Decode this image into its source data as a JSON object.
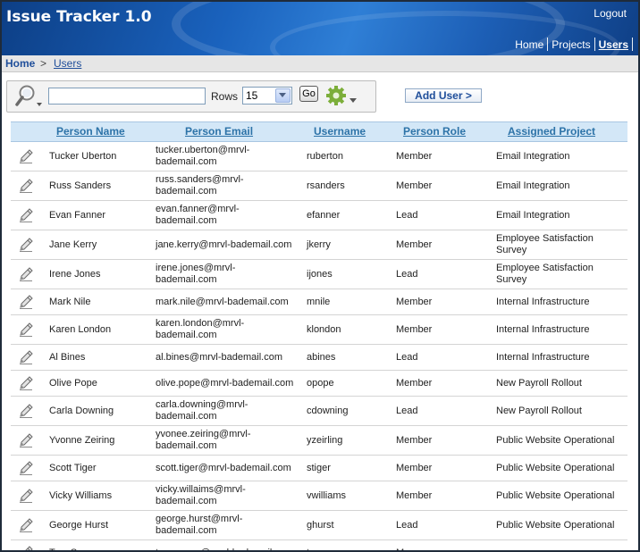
{
  "header": {
    "title": "Issue Tracker 1.0",
    "logout": "Logout",
    "nav": [
      "Home",
      "Projects",
      "Users"
    ],
    "active_nav": "Users"
  },
  "breadcrumb": {
    "home": "Home",
    "separator": ">",
    "current": "Users"
  },
  "toolbar": {
    "search_value": "",
    "rows_label": "Rows",
    "rows_value": "15",
    "go_label": "Go",
    "search_icon": "magnifier-icon",
    "actions_icon": "gear-icon"
  },
  "add_user_label": "Add User >",
  "table": {
    "columns": [
      "Person Name",
      "Person Email",
      "Username",
      "Person Role",
      "Assigned Project"
    ],
    "edit_icon": "pencil-icon",
    "rows": [
      {
        "name": "Tucker Uberton",
        "email": [
          "tucker.uberton@mrvl-",
          "bademail.com"
        ],
        "username": "ruberton",
        "role": "Member",
        "project": [
          "Email Integration"
        ]
      },
      {
        "name": "Russ Sanders",
        "email": [
          "russ.sanders@mrvl-",
          "bademail.com"
        ],
        "username": "rsanders",
        "role": "Member",
        "project": [
          "Email Integration"
        ]
      },
      {
        "name": "Evan Fanner",
        "email": [
          "evan.fanner@mrvl-",
          "bademail.com"
        ],
        "username": "efanner",
        "role": "Lead",
        "project": [
          "Email Integration"
        ]
      },
      {
        "name": "Jane Kerry",
        "email": [
          "jane.kerry@mrvl-bademail.com"
        ],
        "username": "jkerry",
        "role": "Member",
        "project": [
          "Employee Satisfaction",
          "Survey"
        ]
      },
      {
        "name": "Irene Jones",
        "email": [
          "irene.jones@mrvl-",
          "bademail.com"
        ],
        "username": "ijones",
        "role": "Lead",
        "project": [
          "Employee Satisfaction",
          "Survey"
        ]
      },
      {
        "name": "Mark Nile",
        "email": [
          "mark.nile@mrvl-bademail.com"
        ],
        "username": "mnile",
        "role": "Member",
        "project": [
          "Internal Infrastructure"
        ]
      },
      {
        "name": "Karen London",
        "email": [
          "karen.london@mrvl-",
          "bademail.com"
        ],
        "username": "klondon",
        "role": "Member",
        "project": [
          "Internal Infrastructure"
        ]
      },
      {
        "name": "Al Bines",
        "email": [
          "al.bines@mrvl-bademail.com"
        ],
        "username": "abines",
        "role": "Lead",
        "project": [
          "Internal Infrastructure"
        ]
      },
      {
        "name": "Olive Pope",
        "email": [
          "olive.pope@mrvl-bademail.com"
        ],
        "username": "opope",
        "role": "Member",
        "project": [
          "New Payroll Rollout"
        ]
      },
      {
        "name": "Carla Downing",
        "email": [
          "carla.downing@mrvl-",
          "bademail.com"
        ],
        "username": "cdowning",
        "role": "Lead",
        "project": [
          "New Payroll Rollout"
        ]
      },
      {
        "name": "Yvonne Zeiring",
        "email": [
          "yvonee.zeiring@mrvl-",
          "bademail.com"
        ],
        "username": "yzeirling",
        "role": "Member",
        "project": [
          "Public Website Operational"
        ]
      },
      {
        "name": "Scott Tiger",
        "email": [
          "scott.tiger@mrvl-bademail.com"
        ],
        "username": "stiger",
        "role": "Member",
        "project": [
          "Public Website Operational"
        ]
      },
      {
        "name": "Vicky Williams",
        "email": [
          "vicky.willaims@mrvl-",
          "bademail.com"
        ],
        "username": "vwilliams",
        "role": "Member",
        "project": [
          "Public Website Operational"
        ]
      },
      {
        "name": "George Hurst",
        "email": [
          "george.hurst@mrvl-",
          "bademail.com"
        ],
        "username": "ghurst",
        "role": "Lead",
        "project": [
          "Public Website Operational"
        ]
      },
      {
        "name": "Tom Suess",
        "email": [
          "tom.suess@mrvl-bademail.com"
        ],
        "username": "tsuess",
        "role": "Manager",
        "project": [
          "-"
        ]
      }
    ]
  }
}
